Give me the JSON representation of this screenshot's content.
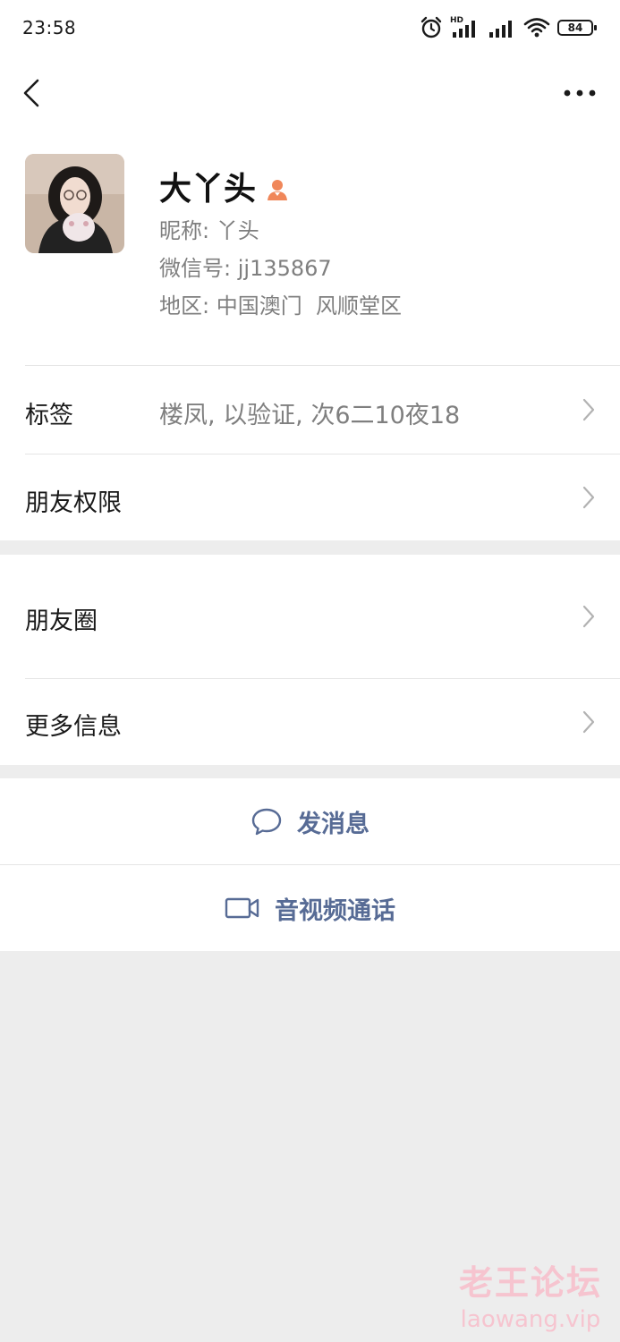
{
  "status_bar": {
    "time": "23:58",
    "network_label": "HD",
    "battery": "84",
    "icons": [
      "alarm-icon",
      "signal-hd-icon",
      "signal-icon",
      "wifi-icon",
      "battery-icon"
    ]
  },
  "nav": {
    "back_icon": "chevron-left-icon",
    "more_icon": "more-dots-icon"
  },
  "profile": {
    "display_name": "大丫头",
    "gender_icon": "female-icon",
    "gender_color": "#fa5151",
    "nickname_label": "昵称:",
    "nickname": "丫头",
    "wechat_id_label": "微信号:",
    "wechat_id": "jj135867",
    "region_label": "地区:",
    "region": "中国澳门  风顺堂区"
  },
  "rows": {
    "tags": {
      "label": "标签",
      "value": "楼凤, 以验证, 次6二10夜18"
    },
    "permissions": {
      "label": "朋友权限"
    },
    "moments": {
      "label": "朋友圈"
    },
    "more_info": {
      "label": "更多信息"
    }
  },
  "actions": {
    "message": {
      "label": "发消息",
      "icon": "chat-bubble-icon"
    },
    "call": {
      "label": "音视频通话",
      "icon": "video-camera-icon"
    }
  },
  "colors": {
    "link_blue": "#576b95",
    "background": "#ededed"
  },
  "watermark": {
    "text_cn": "老王论坛",
    "text_en": "laowang.vip"
  }
}
